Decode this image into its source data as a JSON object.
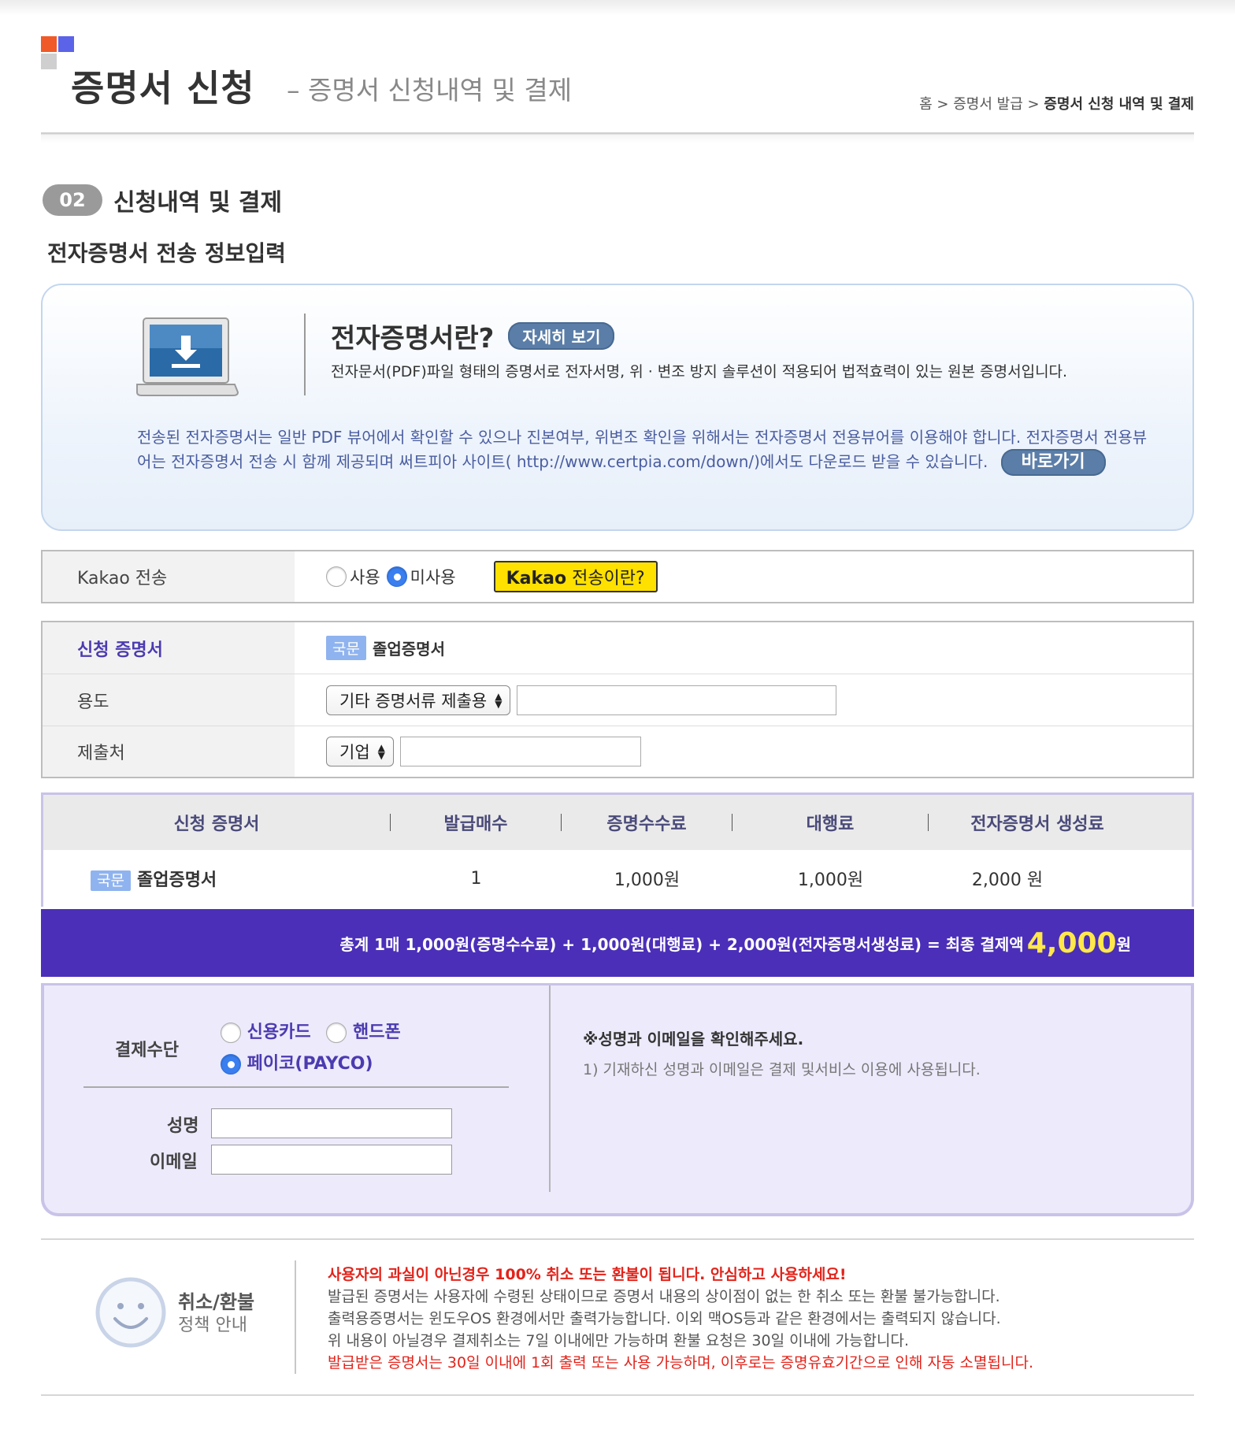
{
  "header": {
    "title": "증명서 신청",
    "subtitle": "– 증명서 신청내역 및 결제",
    "breadcrumb": [
      "홈",
      "증명서 발급",
      "증명서 신청 내역 및 결제"
    ],
    "breadcrumb_sep": ">"
  },
  "step": {
    "number": "02",
    "label": "신청내역 및 결제"
  },
  "section_title": "전자증명서 전송 정보입력",
  "info": {
    "title": "전자증명서란?",
    "detail_button": "자세히 보기",
    "desc": "전자문서(PDF)파일 형태의 증명서로 전자서명, 위 · 변조 방지 솔루션이 적용되어 법적효력이 있는 원본 증명서입니다.",
    "long": "전송된 전자증명서는 일반 PDF 뷰어에서 확인할 수 있으나 진본여부, 위변조 확인을 위해서는 전자증명서 전용뷰어를 이용해야 합니다. 전자증명서 전용뷰어는 전자증명서 전송 시 함께 제공되며 써트피아 사이트( http://www.certpia.com/down/)에서도 다운로드 받을 수 있습니다.",
    "go_button": "바로가기"
  },
  "kakao": {
    "label": "Kakao 전송",
    "options": [
      "사용",
      "미사용"
    ],
    "selected": "미사용",
    "button_bold": "Kakao",
    "button_rest": " 전송이란?"
  },
  "form": {
    "cert_label": "신청 증명서",
    "cert_tag": "국문",
    "cert_name": "졸업증명서",
    "purpose_label": "용도",
    "purpose_value": "기타 증명서류 제출용",
    "purpose_input": "",
    "dest_label": "제출처",
    "dest_value": "기업",
    "dest_input": ""
  },
  "fee_table": {
    "headers": [
      "신청 증명서",
      "발급매수",
      "증명수수료",
      "대행료",
      "전자증명서 생성료"
    ],
    "row": {
      "tag": "국문",
      "name": "졸업증명서",
      "count": "1",
      "fee": "1,000원",
      "agency": "1,000원",
      "gen": "2,000 원"
    }
  },
  "total": {
    "text": "총계 1매 1,000원(증명수수료) + 1,000원(대행료) + 2,000원(전자증명서생성료) = 최종 결제액",
    "amount": "4,000",
    "unit": "원"
  },
  "payment": {
    "label": "결제수단",
    "options": [
      "신용카드",
      "핸드폰",
      "페이코(PAYCO)"
    ],
    "selected": "페이코(PAYCO)",
    "name_label": "성명",
    "email_label": "이메일",
    "name_value": "",
    "email_value": "",
    "note_title": "※성명과 이메일을 확인해주세요.",
    "note_text": "1) 기재하신 성명과 이메일은 결제 및서비스 이용에 사용됩니다."
  },
  "policy": {
    "title": "취소/환불",
    "subtitle": "정책 안내",
    "lines": [
      "사용자의 과실이 아닌경우 100% 취소 또는 환불이 됩니다. 안심하고 사용하세요!",
      "발급된 증명서는 사용자에 수령된 상태이므로 증명서 내용의 상이점이 없는 한 취소 또는 환불 불가능합니다.",
      "출력용증명서는 윈도우OS 환경에서만 출력가능합니다. 이외 맥OS등과 같은 환경에서는 출력되지 않습니다.",
      "위 내용이 아닐경우 결제취소는 7일 이내에만 가능하며 환불 요청은 30일 이내에 가능합니다.",
      "발급받은 증명서는 30일 이내에 1회 출력 또는 사용 가능하며, 이후로는 증명유효기간으로 인해 자동 소멸됩니다."
    ]
  },
  "colors": {
    "purple": "#4b2fb8",
    "amount": "#ffe84a",
    "kakao": "#ffe100",
    "red": "#e2231a",
    "tag": "#8fb3ef"
  },
  "icons": [
    "laptop-download-icon",
    "smiley-icon",
    "radio-icon",
    "select-arrows-icon"
  ]
}
